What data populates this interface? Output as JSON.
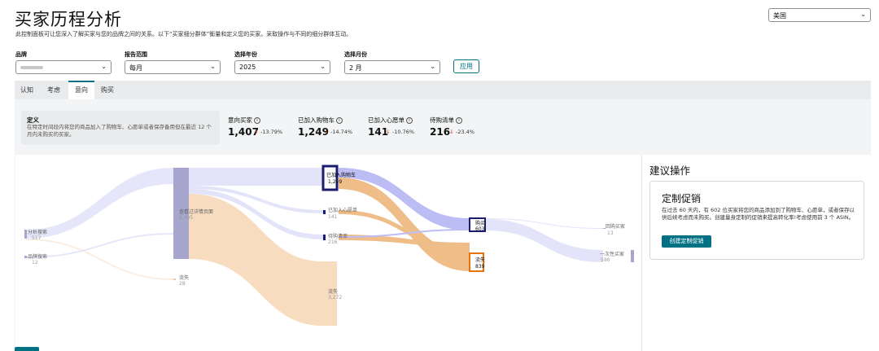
{
  "header": {
    "title": "买家历程分析",
    "subtitle": "此控制面板可让您深入了解买家与您的品牌之间的关系。以下“买家细分群体”衡量和定义您的买家。采取操作与不同的细分群体互动。"
  },
  "marketplace": {
    "value": "美国"
  },
  "filters": {
    "brand": {
      "label": "品牌",
      "value": ""
    },
    "range": {
      "label": "报告范围",
      "value": "每月"
    },
    "year": {
      "label": "选择年份",
      "value": "2025"
    },
    "month": {
      "label": "选择月份",
      "value": "2 月"
    },
    "apply_label": "应用"
  },
  "tabs": [
    {
      "label": "认知",
      "active": false
    },
    {
      "label": "考虑",
      "active": false
    },
    {
      "label": "意向",
      "active": true
    },
    {
      "label": "购买",
      "active": false
    }
  ],
  "definition": {
    "title": "定义",
    "text": "在特定时间段内将您的商品加入了购物车、心愿单或者保存备用但在最近 12 个月内未购买的买家。"
  },
  "metrics": [
    {
      "label": "意向买家",
      "value": "1,407",
      "change": "-13.79%",
      "direction": "down"
    },
    {
      "label": "已加入购物车",
      "value": "1,249",
      "change": "-14.74%",
      "direction": "down"
    },
    {
      "label": "已加入心愿单",
      "value": "141",
      "change": "-10.76%",
      "direction": "down"
    },
    {
      "label": "待购清单",
      "value": "216",
      "change": "-23.4%",
      "direction": "down"
    }
  ],
  "sankey": {
    "nodes": [
      {
        "id": "search",
        "label": "分析搜索",
        "value": "517"
      },
      {
        "id": "brand_search",
        "label": "品牌搜索",
        "value": "12"
      },
      {
        "id": "detail",
        "label": "查看过详情页面",
        "value": "4,405"
      },
      {
        "id": "lost1",
        "label": "流失",
        "value": "28"
      },
      {
        "id": "cart",
        "label": "已加入购物车",
        "value": "1,249"
      },
      {
        "id": "wishlist",
        "label": "已加入心愿单",
        "value": "141"
      },
      {
        "id": "savelist",
        "label": "待购清单",
        "value": "216"
      },
      {
        "id": "lost2",
        "label": "流失",
        "value": "3,272"
      },
      {
        "id": "purchase",
        "label": "购买",
        "value": "603"
      },
      {
        "id": "lost3",
        "label": "流失",
        "value": "839"
      },
      {
        "id": "repeat",
        "label": "回购买家",
        "value": "13"
      },
      {
        "id": "onetime",
        "label": "一次性买家",
        "value": "590"
      }
    ],
    "colors": {
      "blue_flow": "#bdbdf5",
      "light_blue_flow": "#e3e3fa",
      "orange_flow": "#eebd88",
      "light_orange_flow": "#f7dcc0",
      "grey_node": "#a6a6cf",
      "navy_node": "#1c1c6e",
      "orange_node": "#e8720c"
    }
  },
  "action": {
    "heading": "建议操作",
    "card_title": "定制促销",
    "card_text": "在过去 60 天内，有 602 位买家将您的商品添加到了购物车、心愿单，或者保存以供后续考虑而未购买。创建量身定制的促销来提高转化率!考虑使用前 3 个 ASIN。",
    "button_label": "创建定制促销"
  }
}
